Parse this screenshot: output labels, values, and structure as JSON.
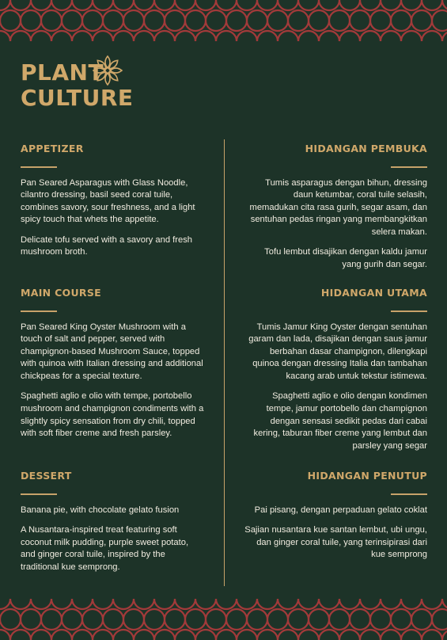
{
  "brand": {
    "line1": "PLANT",
    "line2": "CULTURE",
    "logo_icon": "lotus-mandala-icon"
  },
  "colors": {
    "background": "#1d3328",
    "gold": "#c7a26a",
    "pattern": "#a23a3a",
    "text": "#f1ece0"
  },
  "left": {
    "appetizer": {
      "heading": "APPETIZER",
      "items": [
        "Pan Seared Asparagus with Glass Noodle, cilantro dressing, basil seed coral tuile, combines savory, sour freshness, and a light spicy touch that whets the appetite.",
        "Delicate tofu served with a savory and fresh mushroom broth."
      ]
    },
    "main": {
      "heading": "MAIN COURSE",
      "items": [
        "Pan Seared King Oyster Mushroom with a touch of salt and pepper, served with champignon-based Mushroom Sauce, topped with quinoa with Italian dressing and additional chickpeas for a special texture.",
        "Spaghetti aglio e olio with tempe, portobello mushroom and champignon condiments with a slightly spicy sensation from dry chili, topped with soft fiber creme and fresh parsley."
      ]
    },
    "dessert": {
      "heading": "DESSERT",
      "items": [
        "Banana pie, with chocolate gelato fusion",
        "A Nusantara-inspired treat featuring soft coconut milk pudding, purple sweet potato, and ginger coral tuile, inspired by the traditional kue semprong."
      ]
    }
  },
  "right": {
    "appetizer": {
      "heading": "HIDANGAN PEMBUKA",
      "items": [
        "Tumis asparagus dengan bihun, dressing daun ketumbar,  coral tuile selasih, memadukan cita rasa gurih, segar asam, dan sentuhan pedas ringan yang membangkitkan selera makan.",
        "Tofu lembut disajikan dengan kaldu jamur yang gurih dan segar."
      ]
    },
    "main": {
      "heading": "HIDANGAN UTAMA",
      "items": [
        "Tumis Jamur King Oyster dengan sentuhan garam dan lada, disajikan dengan saus jamur berbahan dasar champignon, dilengkapi quinoa dengan dressing Italia dan tambahan kacang arab untuk tekstur istimewa.",
        "Spaghetti aglio e olio dengan kondimen tempe, jamur portobello dan champignon dengan sensasi sedikit pedas dari cabai kering, taburan fiber creme yang lembut dan parsley yang segar"
      ]
    },
    "dessert": {
      "heading": "HIDANGAN PENUTUP",
      "items": [
        "Pai pisang, dengan perpaduan gelato coklat",
        "Sajian nusantara kue santan lembut, ubi ungu, dan ginger coral tuile, yang terinsipirasi dari kue semprong"
      ]
    }
  }
}
